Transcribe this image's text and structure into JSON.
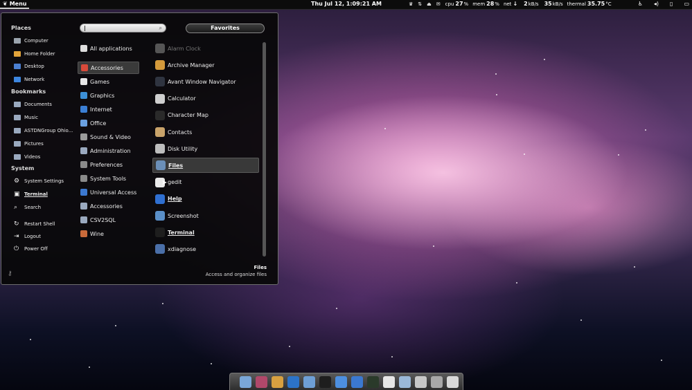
{
  "top_panel": {
    "menu_label": "Menu",
    "clock": "Thu Jul 12,  1:09:21 AM",
    "tray": [
      {
        "label": "cpu",
        "value": "27",
        "unit": "%"
      },
      {
        "label": "mem",
        "value": "28",
        "unit": "%"
      },
      {
        "label": "net",
        "value": "↓",
        "unit": ""
      },
      {
        "label": "",
        "value": "2",
        "unit": "kB/s"
      },
      {
        "label": "",
        "value": "35",
        "unit": "kB/s"
      },
      {
        "label": "thermal",
        "value": "35.75",
        "unit": "°C"
      }
    ]
  },
  "menu": {
    "search_placeholder": "",
    "favorites_label": "Favorites",
    "places_title": "Places",
    "places": [
      {
        "label": "Computer",
        "icon": "computer-icon",
        "color": "#9aa3ad"
      },
      {
        "label": "Home Folder",
        "icon": "home-folder-icon",
        "color": "#e2a33a"
      },
      {
        "label": "Desktop",
        "icon": "desktop-icon",
        "color": "#4b7fd1"
      },
      {
        "label": "Network",
        "icon": "network-icon",
        "color": "#3d86e0"
      }
    ],
    "bookmarks_title": "Bookmarks",
    "bookmarks": [
      {
        "label": "Documents",
        "icon": "folder-icon",
        "color": "#9aa9bf"
      },
      {
        "label": "Music",
        "icon": "folder-icon",
        "color": "#9aa9bf"
      },
      {
        "label": "ASTDNGroup Ohio...",
        "icon": "folder-icon",
        "color": "#9aa9bf"
      },
      {
        "label": "Pictures",
        "icon": "folder-icon",
        "color": "#9aa9bf"
      },
      {
        "label": "Videos",
        "icon": "folder-icon",
        "color": "#9aa9bf"
      }
    ],
    "system_title": "System",
    "system": [
      {
        "label": "System Settings",
        "icon": "settings-icon",
        "bold": false
      },
      {
        "label": "Terminal",
        "icon": "terminal-icon",
        "bold": true
      },
      {
        "label": "Search",
        "icon": "search-icon",
        "bold": false
      }
    ],
    "session": [
      {
        "label": "Restart Shell",
        "icon": "restart-icon"
      },
      {
        "label": "Logout",
        "icon": "logout-icon"
      },
      {
        "label": "Power Off",
        "icon": "power-icon"
      }
    ],
    "categories": [
      {
        "label": "All applications",
        "icon": "gnome-foot-icon",
        "color": "#dddddd",
        "selected": false
      },
      {
        "label": "Accessories",
        "icon": "accessories-icon",
        "color": "#d84a3a",
        "selected": true
      },
      {
        "label": "Games",
        "icon": "games-icon",
        "color": "#e7e7e7",
        "selected": false
      },
      {
        "label": "Graphics",
        "icon": "graphics-icon",
        "color": "#3c8fd6",
        "selected": false
      },
      {
        "label": "Internet",
        "icon": "internet-icon",
        "color": "#3b7fd4",
        "selected": false
      },
      {
        "label": "Office",
        "icon": "office-icon",
        "color": "#6aa0e0",
        "selected": false
      },
      {
        "label": "Sound & Video",
        "icon": "sound-video-icon",
        "color": "#9a9a9a",
        "selected": false
      },
      {
        "label": "Administration",
        "icon": "folder-icon",
        "color": "#9aa9bf",
        "selected": false
      },
      {
        "label": "Preferences",
        "icon": "preferences-icon",
        "color": "#8a8a8a",
        "selected": false
      },
      {
        "label": "System Tools",
        "icon": "system-tools-icon",
        "color": "#8a8a8a",
        "selected": false
      },
      {
        "label": "Universal Access",
        "icon": "accessibility-icon",
        "color": "#3b78d0",
        "selected": false
      },
      {
        "label": "Accessories",
        "icon": "folder-icon",
        "color": "#9aa9bf",
        "selected": false
      },
      {
        "label": "CSV2SQL",
        "icon": "folder-icon",
        "color": "#9aa9bf",
        "selected": false
      },
      {
        "label": "Wine",
        "icon": "wine-icon",
        "color": "#c96a3a",
        "selected": false
      }
    ],
    "apps": [
      {
        "label": "Alarm Clock",
        "icon": "alarm-clock-icon",
        "color": "#555555",
        "dim": true,
        "bold": false,
        "selected": false
      },
      {
        "label": "Archive Manager",
        "icon": "archive-icon",
        "color": "#d49a3b",
        "dim": false,
        "bold": false,
        "selected": false
      },
      {
        "label": "Avant Window Navigator",
        "icon": "awn-icon",
        "color": "#2f3440",
        "dim": false,
        "bold": false,
        "selected": false
      },
      {
        "label": "Calculator",
        "icon": "calculator-icon",
        "color": "#cfcfcf",
        "dim": false,
        "bold": false,
        "selected": false
      },
      {
        "label": "Character Map",
        "icon": "character-map-icon",
        "color": "#2a2a2a",
        "dim": false,
        "bold": false,
        "selected": false
      },
      {
        "label": "Contacts",
        "icon": "contacts-icon",
        "color": "#c9a36a",
        "dim": false,
        "bold": false,
        "selected": false
      },
      {
        "label": "Disk Utility",
        "icon": "disk-utility-icon",
        "color": "#bdbdbd",
        "dim": false,
        "bold": false,
        "selected": false
      },
      {
        "label": "Files",
        "icon": "files-icon",
        "color": "#6b8fb8",
        "dim": false,
        "bold": true,
        "selected": true
      },
      {
        "label": "gedit",
        "icon": "gedit-icon",
        "color": "#e9e9e9",
        "dim": false,
        "bold": false,
        "selected": false
      },
      {
        "label": "Help",
        "icon": "help-icon",
        "color": "#2f6fd0",
        "dim": false,
        "bold": true,
        "selected": false
      },
      {
        "label": "Screenshot",
        "icon": "screenshot-icon",
        "color": "#5a8fc8",
        "dim": false,
        "bold": false,
        "selected": false
      },
      {
        "label": "Terminal",
        "icon": "terminal-icon",
        "color": "#1e1e1e",
        "dim": false,
        "bold": true,
        "selected": false
      },
      {
        "label": "xdiagnose",
        "icon": "xdiagnose-icon",
        "color": "#4a6fa8",
        "dim": false,
        "bold": false,
        "selected": false
      }
    ],
    "description": {
      "title": "Files",
      "text": "Access and organize files"
    }
  },
  "dock": {
    "items": [
      {
        "icon": "finder-icon",
        "color": "#7aa7d8"
      },
      {
        "icon": "photo-icon",
        "color": "#b0486a"
      },
      {
        "icon": "pencil-icon",
        "color": "#d8a040"
      },
      {
        "icon": "firefox-icon",
        "color": "#2c73c8"
      },
      {
        "icon": "home-folder-icon",
        "color": "#6e9fd6"
      },
      {
        "icon": "terminal-icon",
        "color": "#1e1e1e"
      },
      {
        "icon": "chromium-icon",
        "color": "#4d8fe0"
      },
      {
        "icon": "add-icon",
        "color": "#3b78d0"
      },
      {
        "icon": "system-monitor-icon",
        "color": "#2a3a2a"
      },
      {
        "icon": "text-editor-icon",
        "color": "#e6e6e6"
      },
      {
        "icon": "screenshot-icon",
        "color": "#9ab8d8"
      },
      {
        "icon": "settings-icon",
        "color": "#c8c8c8"
      },
      {
        "icon": "trash-icon",
        "color": "#a8a8a8"
      },
      {
        "icon": "power-icon",
        "color": "#d9d9d9"
      }
    ]
  },
  "colors": {
    "panel": "#0c0c0c",
    "menu_bg": "#080808",
    "selection": "#393939"
  }
}
